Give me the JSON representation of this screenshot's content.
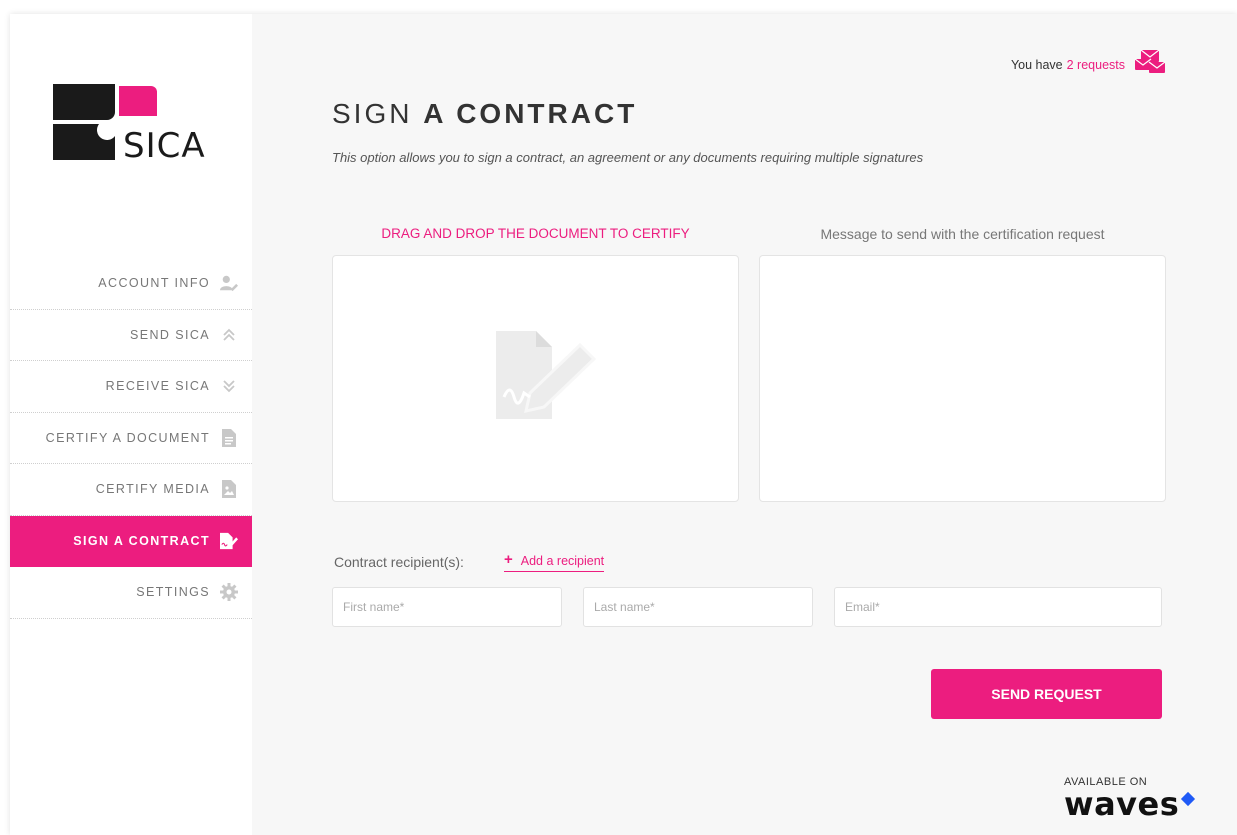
{
  "brand": {
    "name": "SICA",
    "pink": "#ec1d7f",
    "dark": "#1a1a1a"
  },
  "sidebar": {
    "items": [
      {
        "label": "ACCOUNT INFO",
        "icon": "user-edit-icon",
        "active": false
      },
      {
        "label": "SEND SICA",
        "icon": "chevrons-up-icon",
        "active": false
      },
      {
        "label": "RECEIVE SICA",
        "icon": "chevrons-down-icon",
        "active": false
      },
      {
        "label": "CERTIFY A DOCUMENT",
        "icon": "document-icon",
        "active": false
      },
      {
        "label": "CERTIFY MEDIA",
        "icon": "media-file-icon",
        "active": false
      },
      {
        "label": "SIGN A CONTRACT",
        "icon": "sign-contract-icon",
        "active": true
      },
      {
        "label": "SETTINGS",
        "icon": "gear-icon",
        "active": false
      }
    ]
  },
  "header": {
    "requests_prefix": "You have",
    "requests_link": "2 requests",
    "requests_icon": "envelopes-icon"
  },
  "page": {
    "title_light": "SIGN",
    "title_bold": "A CONTRACT",
    "subtitle": "This option allows you to sign a contract, an agreement or any documents requiring multiple signatures"
  },
  "form": {
    "drop_label": "DRAG AND DROP THE DOCUMENT TO CERTIFY",
    "message_label": "Message to send with the certification request",
    "message_value": "",
    "recipients_label": "Contract recipient(s):",
    "add_recipient_label": "Add a recipient",
    "first_name_placeholder": "First name*",
    "last_name_placeholder": "Last name*",
    "email_placeholder": "Email*",
    "send_label": "SEND REQUEST"
  },
  "footer": {
    "available_on": "AVAILABLE ON",
    "platform": "waves",
    "platform_accent": "#1f5af6"
  }
}
